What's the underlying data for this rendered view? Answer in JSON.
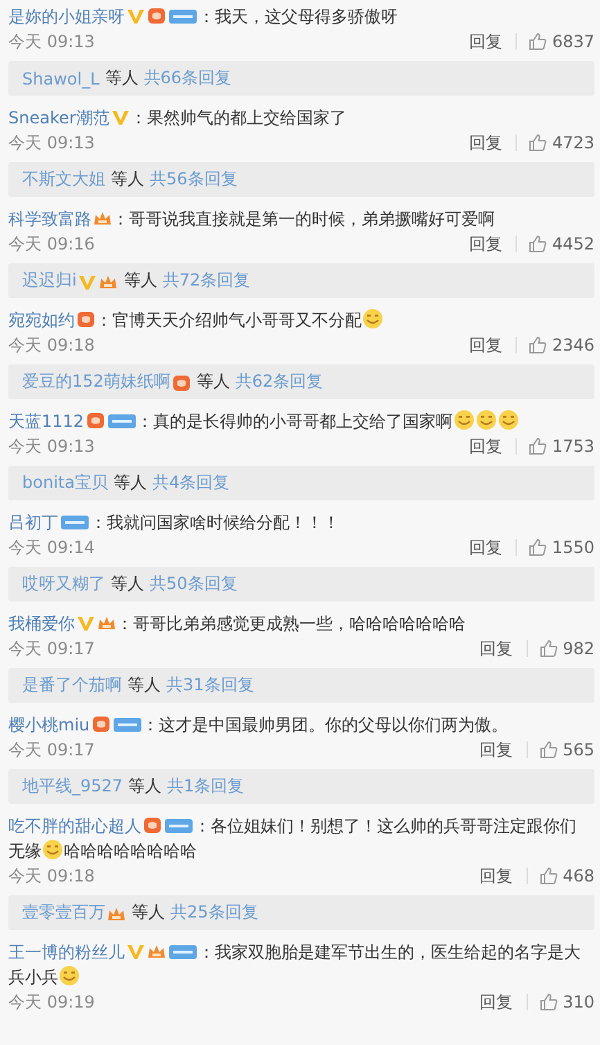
{
  "comments": [
    {
      "user": "是妳的小姐亲呀",
      "badges": [
        {
          "kind": "vip"
        },
        {
          "kind": "fan"
        },
        {
          "kind": "member"
        }
      ],
      "content": [
        {
          "kind": "text",
          "text": "：我天，这父母得多骄傲呀"
        }
      ],
      "time": "今天 09:13",
      "reply": "回复",
      "likes": "6837",
      "replies": {
        "name": "Shawol_L",
        "suffix": "等人",
        "count": "共66条回复"
      }
    },
    {
      "user": "Sneaker潮范",
      "badges": [
        {
          "kind": "vip"
        }
      ],
      "content": [
        {
          "kind": "text",
          "text": "：果然帅气的都上交给国家了"
        }
      ],
      "time": "今天 09:13",
      "reply": "回复",
      "likes": "4723",
      "replies": {
        "name": "不斯文大姐",
        "suffix": "等人",
        "count": "共56条回复"
      }
    },
    {
      "user": "科学致富路",
      "badges": [
        {
          "kind": "crown"
        }
      ],
      "content": [
        {
          "kind": "text",
          "text": "：哥哥说我直接就是第一的时候，弟弟撅嘴好可爱啊"
        }
      ],
      "time": "今天 09:16",
      "reply": "回复",
      "likes": "4452",
      "replies": {
        "name": "迟迟归i",
        "badges": [
          {
            "kind": "vip"
          },
          {
            "kind": "crown"
          }
        ],
        "suffix": "等人",
        "count": "共72条回复"
      }
    },
    {
      "user": "宛宛如约",
      "badges": [
        {
          "kind": "fan"
        }
      ],
      "content": [
        {
          "kind": "text",
          "text": "：官博天天介绍帅气小哥哥又不分配"
        },
        {
          "kind": "emoji"
        }
      ],
      "time": "今天 09:18",
      "reply": "回复",
      "likes": "2346",
      "replies": {
        "name": "爱豆的152萌妹纸啊",
        "badges": [
          {
            "kind": "fan"
          }
        ],
        "suffix": "等人",
        "count": "共62条回复"
      }
    },
    {
      "user": "天蓝1112",
      "badges": [
        {
          "kind": "fan"
        },
        {
          "kind": "member"
        }
      ],
      "content": [
        {
          "kind": "text",
          "text": "：真的是长得帅的小哥哥都上交给了国家啊"
        },
        {
          "kind": "emoji"
        },
        {
          "kind": "emoji"
        },
        {
          "kind": "emoji"
        }
      ],
      "time": "今天 09:13",
      "reply": "回复",
      "likes": "1753",
      "replies": {
        "name": "bonita宝贝",
        "suffix": "等人",
        "count": "共4条回复"
      }
    },
    {
      "user": "吕初丁",
      "badges": [
        {
          "kind": "member"
        }
      ],
      "content": [
        {
          "kind": "text",
          "text": "：我就问国家啥时候给分配！！！"
        }
      ],
      "time": "今天 09:14",
      "reply": "回复",
      "likes": "1550",
      "replies": {
        "name": "哎呀又糊了",
        "suffix": "等人",
        "count": "共50条回复"
      }
    },
    {
      "user": "我桶爱你",
      "badges": [
        {
          "kind": "vip"
        },
        {
          "kind": "crown"
        }
      ],
      "content": [
        {
          "kind": "text",
          "text": "：哥哥比弟弟感觉更成熟一些，哈哈哈哈哈哈哈"
        }
      ],
      "time": "今天 09:17",
      "reply": "回复",
      "likes": "982",
      "replies": {
        "name": "是番了个茄啊",
        "suffix": "等人",
        "count": "共31条回复"
      }
    },
    {
      "user": "樱小桃miu",
      "badges": [
        {
          "kind": "fan"
        },
        {
          "kind": "member"
        }
      ],
      "content": [
        {
          "kind": "text",
          "text": "：这才是中国最帅男团。你的父母以你们两为傲。"
        }
      ],
      "time": "今天 09:17",
      "reply": "回复",
      "likes": "565",
      "replies": {
        "name": "地平线_9527",
        "suffix": "等人",
        "count": "共1条回复"
      }
    },
    {
      "user": "吃不胖的甜心超人",
      "badges": [
        {
          "kind": "fan"
        },
        {
          "kind": "member"
        }
      ],
      "content": [
        {
          "kind": "text",
          "text": "：各位姐妹们！别想了！这么帅的兵哥哥注定跟你们"
        },
        {
          "kind": "text",
          "text": "无缘"
        },
        {
          "kind": "emoji"
        },
        {
          "kind": "text",
          "text": "哈哈哈哈哈哈哈哈"
        }
      ],
      "time": "今天 09:18",
      "reply": "回复",
      "likes": "468",
      "replies": {
        "name": "壹零壹百万",
        "badges": [
          {
            "kind": "crown"
          }
        ],
        "suffix": "等人",
        "count": "共25条回复"
      }
    },
    {
      "user": "王一博的粉丝儿",
      "badges": [
        {
          "kind": "vip"
        },
        {
          "kind": "crown"
        },
        {
          "kind": "member"
        }
      ],
      "content": [
        {
          "kind": "text",
          "text": "：我家双胞胎是建军节出生的，医生给起的名字是大"
        },
        {
          "kind": "text",
          "text": "兵小兵"
        },
        {
          "kind": "emoji"
        }
      ],
      "time": "今天 09:19",
      "reply": "回复",
      "likes": "310"
    }
  ]
}
